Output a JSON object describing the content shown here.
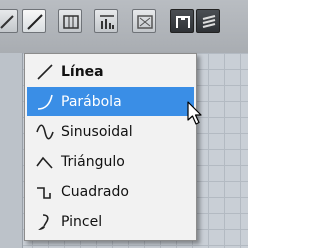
{
  "toolbar": {
    "buttons": [
      "line-tool-icon",
      "velocity-icon",
      "grid-icon",
      "dark-quantize-icon",
      "glue-icon",
      "snap-icon",
      "more-icon"
    ]
  },
  "menu": {
    "items": [
      {
        "label": "Línea",
        "icon": "line-icon",
        "bold": true
      },
      {
        "label": "Parábola",
        "icon": "parabola-icon",
        "selected": true
      },
      {
        "label": "Sinusoidal",
        "icon": "sine-icon"
      },
      {
        "label": "Triángulo",
        "icon": "triangle-icon"
      },
      {
        "label": "Cuadrado",
        "icon": "square-wave-icon"
      },
      {
        "label": "Pincel",
        "icon": "brush-icon"
      }
    ]
  },
  "colors": {
    "selection": "#3a8ee6",
    "menu_bg": "#f2f2f2",
    "grid_bg": "#c9cfd6"
  }
}
